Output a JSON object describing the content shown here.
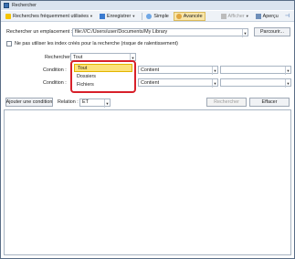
{
  "window": {
    "title": "Rechercher"
  },
  "toolbar": {
    "favorites_label": "Recherches fréquemment utilisées",
    "save_label": "Enregistrer",
    "simple_label": "Simple",
    "advanced_label": "Avancée",
    "display_label": "Afficher",
    "preview_label": "Aperçu"
  },
  "location": {
    "label": "Rechercher un emplacement :",
    "value": "file:///C:/Users/user/Documents/My Library",
    "browse_label": "Parcourir..."
  },
  "index_option": {
    "label": "Ne pas utiliser les index créés pour la recherche (risque de ralentissement)"
  },
  "search_in": {
    "label": "Rechercher :",
    "value": "Tout"
  },
  "conditions": [
    {
      "label": "Condition :",
      "operator": "Contient"
    },
    {
      "label": "Condition :",
      "operator": "Contient"
    }
  ],
  "controls": {
    "add_condition_label": "Ajouter une condition",
    "relation_label": "Relation :",
    "relation_value": "ET",
    "search_button": "Rechercher",
    "clear_button": "Effacer"
  },
  "dropdown": {
    "options": [
      "Tout",
      "Dossiers",
      "Fichiers"
    ],
    "selected_index": 0,
    "highlight_color": "#d8202a"
  }
}
